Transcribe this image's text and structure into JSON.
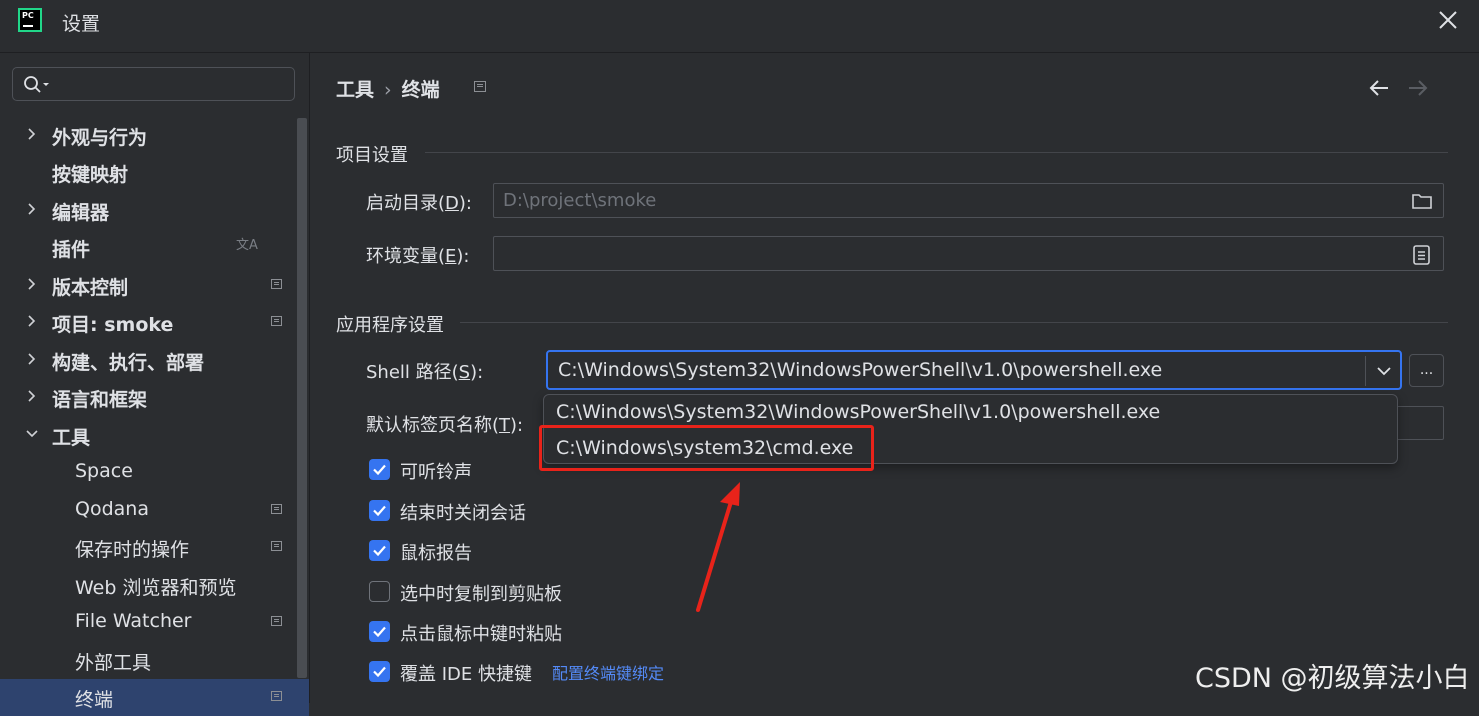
{
  "window": {
    "title": "设置",
    "logo_text": "PC"
  },
  "sidebar": {
    "search": {
      "placeholder": ""
    },
    "items": [
      {
        "label": "外观与行为",
        "expandable": true,
        "level": 1
      },
      {
        "label": "按键映射",
        "expandable": false,
        "level": 1
      },
      {
        "label": "编辑器",
        "expandable": true,
        "level": 1
      },
      {
        "label": "插件",
        "expandable": false,
        "level": 1,
        "icon": "translate-icon"
      },
      {
        "label": "版本控制",
        "expandable": true,
        "level": 1,
        "project_icon": true
      },
      {
        "label": "项目: smoke",
        "expandable": true,
        "level": 1,
        "project_icon": true
      },
      {
        "label": "构建、执行、部署",
        "expandable": true,
        "level": 1
      },
      {
        "label": "语言和框架",
        "expandable": true,
        "level": 1
      },
      {
        "label": "工具",
        "expandable": true,
        "expanded": true,
        "level": 1
      },
      {
        "label": "Space",
        "level": 2
      },
      {
        "label": "Qodana",
        "level": 2,
        "project_icon": true
      },
      {
        "label": "保存时的操作",
        "level": 2,
        "project_icon": true
      },
      {
        "label": "Web 浏览器和预览",
        "level": 2
      },
      {
        "label": "File Watcher",
        "level": 2,
        "project_icon": true
      },
      {
        "label": "外部工具",
        "level": 2
      },
      {
        "label": "终端",
        "level": 2,
        "selected": true,
        "project_icon": true
      }
    ]
  },
  "breadcrumb": {
    "parent": "工具",
    "separator": "›",
    "current": "终端"
  },
  "sections": {
    "project": "项目设置",
    "application": "应用程序设置"
  },
  "fields": {
    "start_dir": {
      "label": "启动目录(",
      "mnemonic": "D",
      "label_end": "):",
      "value": "D:\\project\\smoke"
    },
    "env_vars": {
      "label": "环境变量(",
      "mnemonic": "E",
      "label_end": "):",
      "value": ""
    },
    "shell_path": {
      "label": "Shell 路径(",
      "mnemonic": "S",
      "label_end": "):",
      "value": "C:\\Windows\\System32\\WindowsPowerShell\\v1.0\\powershell.exe",
      "ellipsis": "..."
    },
    "tab_name": {
      "label": "默认标签页名称(",
      "mnemonic": "T",
      "label_end": "):"
    }
  },
  "shell_options": [
    "C:\\Windows\\System32\\WindowsPowerShell\\v1.0\\powershell.exe",
    "C:\\Windows\\system32\\cmd.exe"
  ],
  "checkboxes": [
    {
      "label": "可听铃声",
      "checked": true
    },
    {
      "label": "结束时关闭会话",
      "checked": true
    },
    {
      "label": "鼠标报告",
      "checked": true
    },
    {
      "label": "选中时复制到剪贴板",
      "checked": false
    },
    {
      "label": "点击鼠标中键时粘贴",
      "checked": true
    },
    {
      "label": "覆盖 IDE 快捷键",
      "checked": true,
      "link": "配置终端键绑定"
    }
  ],
  "watermark": "CSDN @初级算法小白",
  "colors": {
    "background": "#2b2d30",
    "accent": "#3574f0",
    "selection": "#2e436e",
    "link": "#548af7",
    "annotation_red": "#e8231a"
  }
}
